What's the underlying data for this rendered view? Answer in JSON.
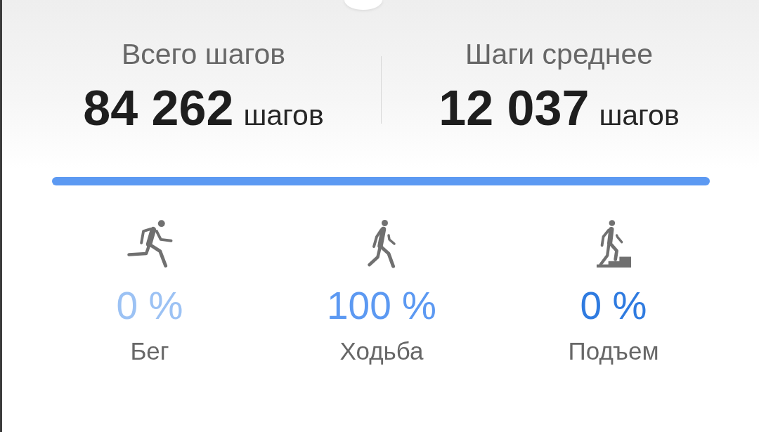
{
  "summary": [
    {
      "label": "Всего шагов",
      "value": "84 262",
      "unit": "шагов"
    },
    {
      "label": "Шаги среднее",
      "value": "12 037",
      "unit": "шагов"
    }
  ],
  "activities": [
    {
      "kind": "run",
      "percent": "0 %",
      "label": "Бег",
      "color": "#9cc2f4"
    },
    {
      "kind": "walk",
      "percent": "100 %",
      "label": "Ходьба",
      "level": 1,
      "color": "#5c99f2"
    },
    {
      "kind": "climb",
      "percent": "0 %",
      "label": "Подъем",
      "color": "#2f7be0"
    }
  ]
}
